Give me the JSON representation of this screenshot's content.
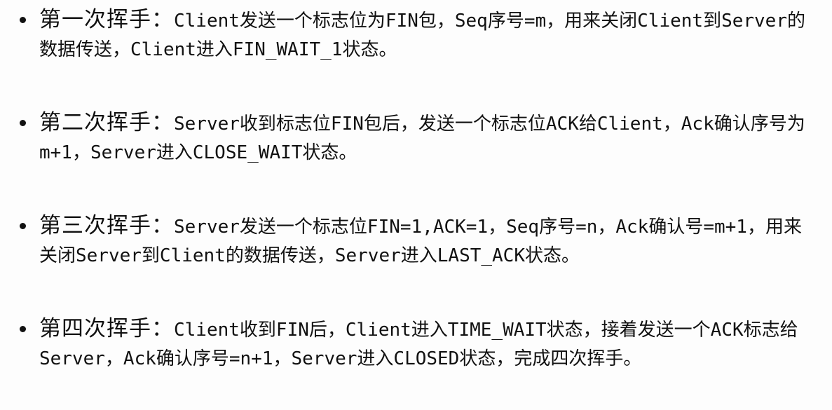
{
  "steps": [
    {
      "title": "第一次挥手：",
      "text": "Client发送一个标志位为FIN包，Seq序号=m，用来关闭Client到Server的数据传送，Client进入FIN_WAIT_1状态。"
    },
    {
      "title": "第二次挥手：",
      "text": "Server收到标志位FIN包后，发送一个标志位ACK给Client，Ack确认序号为m+1，Server进入CLOSE_WAIT状态。"
    },
    {
      "title": "第三次挥手：",
      "text": "Server发送一个标志位FIN=1,ACK=1，Seq序号=n，Ack确认号=m+1，用来关闭Server到Client的数据传送，Server进入LAST_ACK状态。"
    },
    {
      "title": "第四次挥手：",
      "text": "Client收到FIN后，Client进入TIME_WAIT状态，接着发送一个ACK标志给Server，Ack确认序号=n+1，Server进入CLOSED状态，完成四次挥手。"
    }
  ]
}
